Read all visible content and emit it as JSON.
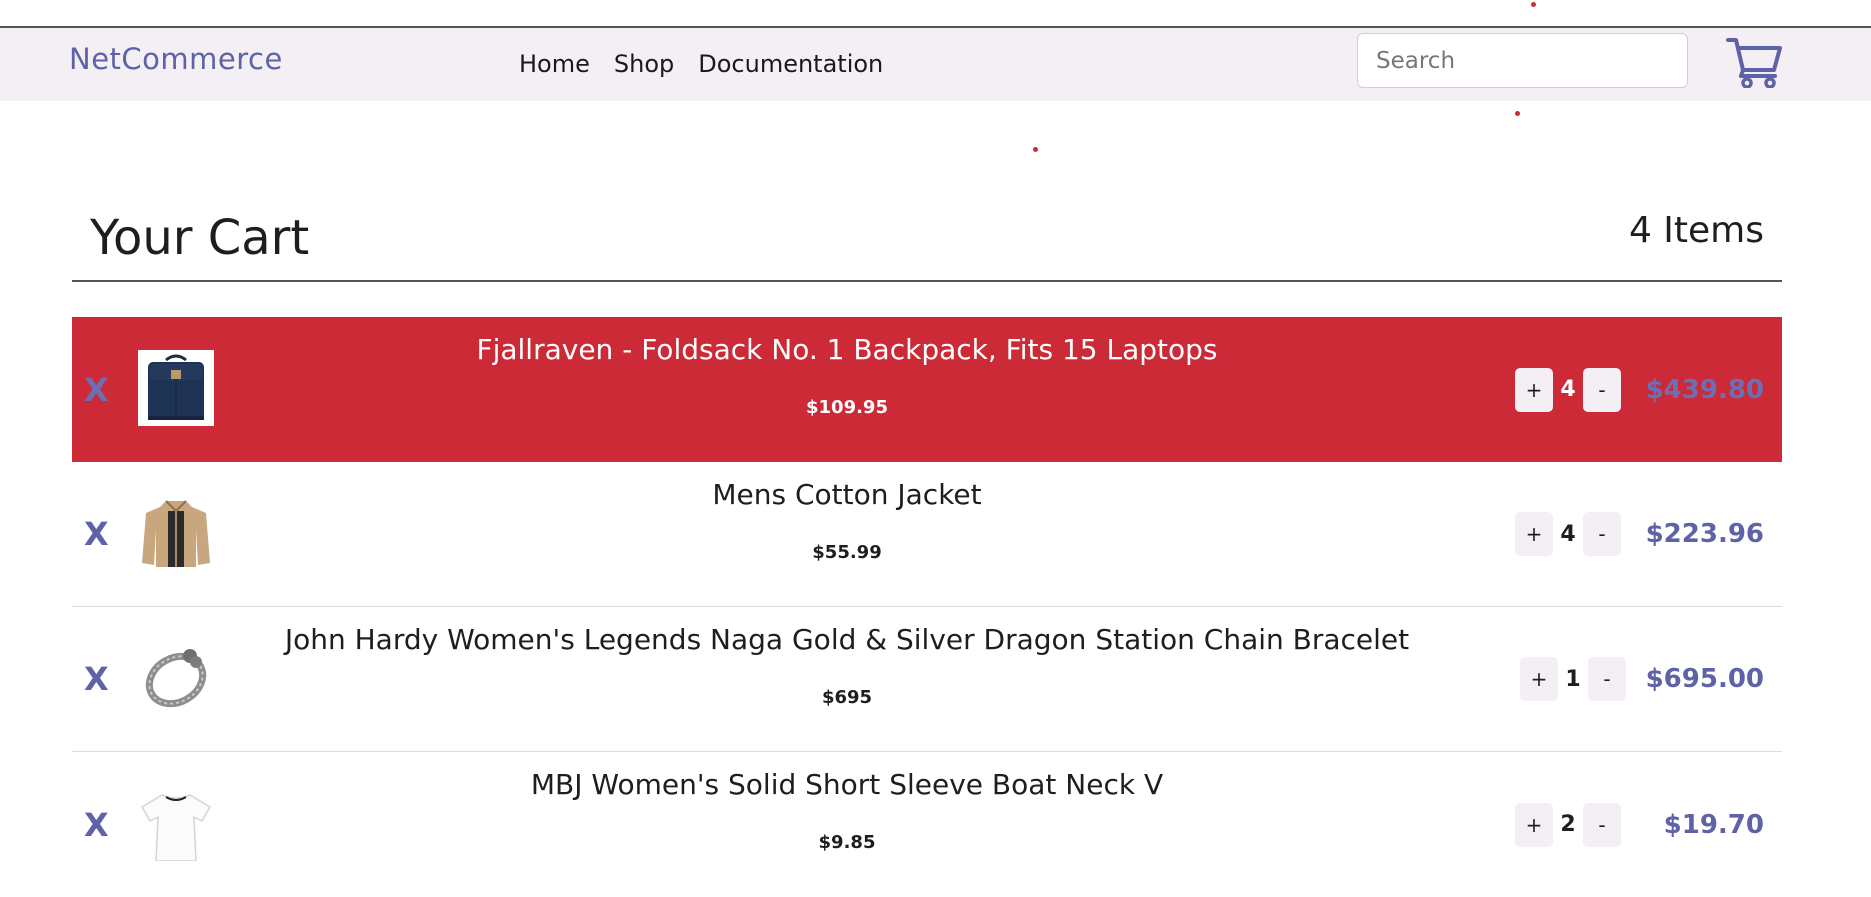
{
  "header": {
    "brand": "NetCommerce",
    "nav": [
      "Home",
      "Shop",
      "Documentation"
    ],
    "search_placeholder": "Search"
  },
  "cart": {
    "title": "Your Cart",
    "count_label": "4 Items",
    "items": [
      {
        "name": "Fjallraven - Foldsack No. 1 Backpack, Fits 15 Laptops",
        "price": "$109.95",
        "qty": "4",
        "total": "$439.80",
        "image": "backpack-image"
      },
      {
        "name": "Mens Cotton Jacket",
        "price": "$55.99",
        "qty": "4",
        "total": "$223.96",
        "image": "jacket-image"
      },
      {
        "name": "John Hardy Women's Legends Naga Gold & Silver Dragon Station Chain Bracelet",
        "price": "$695",
        "qty": "1",
        "total": "$695.00",
        "image": "bracelet-image"
      },
      {
        "name": "MBJ Women's Solid Short Sleeve Boat Neck V",
        "price": "$9.85",
        "qty": "2",
        "total": "$19.70",
        "image": "shirt-image"
      }
    ]
  },
  "labels": {
    "remove": "X",
    "plus": "+",
    "minus": "-"
  },
  "colors": {
    "accent": "#5e63a8",
    "highlight": "#cc2a36",
    "navbar": "#f3eff5"
  }
}
